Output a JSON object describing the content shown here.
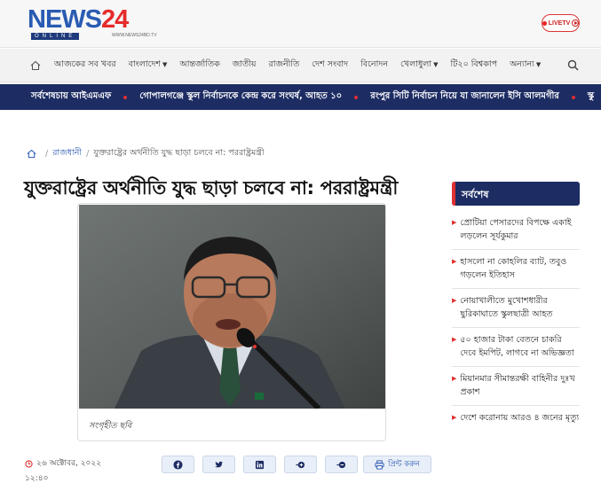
{
  "header": {
    "logo_main": "NEWS",
    "logo_num": "24",
    "logo_sub": "ONLINE",
    "logo_url": "WWW.NEWS24BD.TV",
    "live_label": "LIVETV"
  },
  "nav": {
    "items": [
      {
        "label": "আজকের সব খবর",
        "dropdown": false
      },
      {
        "label": "বাংলাদেশ",
        "dropdown": true
      },
      {
        "label": "আন্তর্জাতিক",
        "dropdown": false
      },
      {
        "label": "জাতীয়",
        "dropdown": false
      },
      {
        "label": "রাজনীতি",
        "dropdown": false
      },
      {
        "label": "দেশ সংবাদ",
        "dropdown": false
      },
      {
        "label": "বিনোদন",
        "dropdown": false
      },
      {
        "label": "খেলাধুলা",
        "dropdown": true
      },
      {
        "label": "টি২০ বিশ্বকাপ",
        "dropdown": false
      },
      {
        "label": "অন্যান্য",
        "dropdown": true
      }
    ]
  },
  "ticker": {
    "label": "সর্বশেষ",
    "items": [
      "চায় আইএমএফ",
      "গোপালগঞ্জে স্কুল নির্বাচনকে কেন্দ্র করে সংঘর্ষ, আহত ১০",
      "রংপুর সিটি নির্বাচন নিয়ে যা জানালেন ইসি আলমগীর",
      "স্কু"
    ]
  },
  "breadcrumb": {
    "section": "রাজধানী",
    "current": "যুক্তরাষ্ট্রের অর্থনীতি যুদ্ধ ছাড়া চলবে না: পররাষ্ট্রমন্ত্রী"
  },
  "article": {
    "headline": "যুক্তরাষ্ট্রের অর্থনীতি যুদ্ধ ছাড়া চলবে না: পররাষ্ট্রমন্ত্রী",
    "caption": "সংগৃহীত ছবি",
    "date": "২৬ অক্টোবর, ২০২২",
    "time": "১২:৪০",
    "print_label": "প্রিন্ট করুন"
  },
  "sidebar": {
    "title": "সর্বশেষ",
    "items": [
      "প্রোটিয়া পেসারদের বিপক্ষে একাই লড়লেন সূর্যকুমার",
      "হাসলো না কোহলির ব্যাট, তবুও গড়লেন ইতিহাস",
      "নোয়াখালীতে মুখোশধারীর ছুরিকাঘাতে স্কুলছাত্রী আহত",
      "৫০ হাজার টাকা বেতনে চাকরি দেবে ইমপিট, লাগবে না অভিজ্ঞতা",
      "মিয়ানমার সীমান্তরক্ষী বাহিনীর দুঃখ প্রকাশ",
      "দেশে করোনায় আরও ৪ জনের মৃত্যু"
    ]
  },
  "colors": {
    "brand_navy": "#1d2c63",
    "accent_red": "#e03131",
    "link_blue": "#2656b0"
  }
}
